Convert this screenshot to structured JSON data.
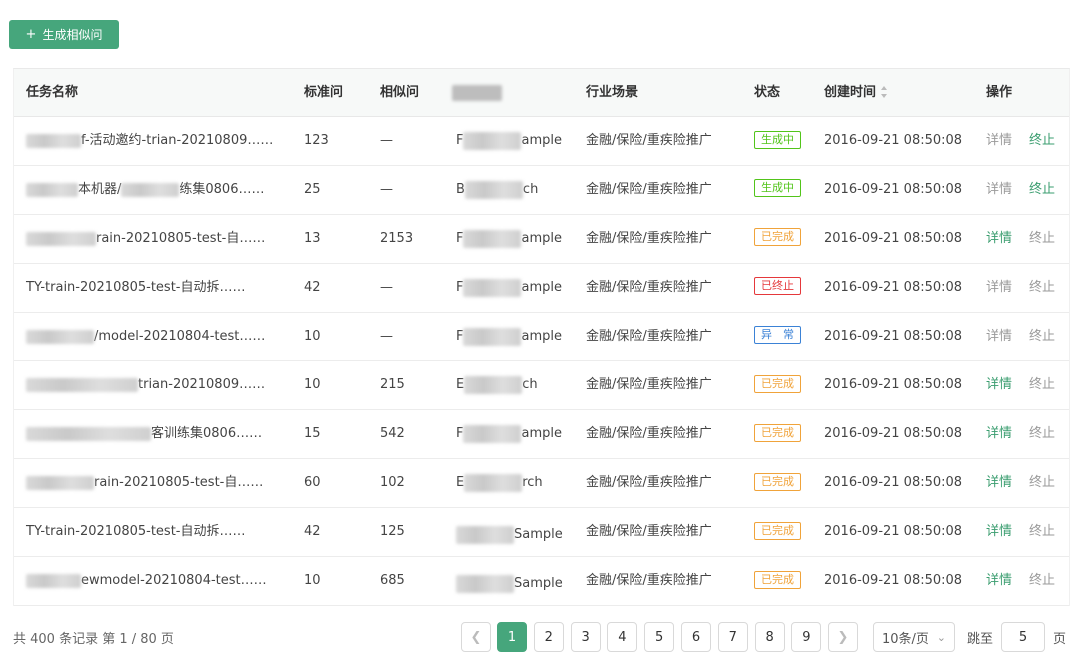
{
  "toolbar": {
    "generate_label": "生成相似问",
    "plus": "+"
  },
  "table": {
    "headers": {
      "name": "任务名称",
      "standard": "标准问",
      "similar": "相似问",
      "model": "",
      "industry": "行业场景",
      "status": "状态",
      "created": "创建时间",
      "actions": "操作"
    },
    "action_labels": {
      "detail": "详情",
      "stop": "终止"
    },
    "rows": [
      {
        "name": "f-活动邀约-trian-20210809……",
        "std": "123",
        "sim": "—",
        "model_pre": "F",
        "model_post": "ample",
        "industry": "金融/保险/重疾险推广",
        "status": "生成中",
        "time": "2016-09-21  08:50:08"
      },
      {
        "name": "本机器/",
        "name2": "练集0806……",
        "std": "25",
        "sim": "—",
        "model_pre": "B",
        "model_post": "ch",
        "industry": "金融/保险/重疾险推广",
        "status": "生成中",
        "time": "2016-09-21  08:50:08"
      },
      {
        "name": "rain-20210805-test-自……",
        "std": "13",
        "sim": "2153",
        "model_pre": "F",
        "model_post": "ample",
        "industry": "金融/保险/重疾险推广",
        "status": "已完成",
        "time": "2016-09-21  08:50:08"
      },
      {
        "name": "TY-train-20210805-test-自动拆……",
        "std": "42",
        "sim": "—",
        "model_pre": "F",
        "model_post": "ample",
        "industry": "金融/保险/重疾险推广",
        "status": "已终止",
        "time": "2016-09-21  08:50:08"
      },
      {
        "name": "/model-20210804-test……",
        "std": "10",
        "sim": "—",
        "model_pre": "F",
        "model_post": "ample",
        "industry": "金融/保险/重疾险推广",
        "status": "异　常",
        "time": "2016-09-21  08:50:08"
      },
      {
        "name": "trian-20210809……",
        "std": "10",
        "sim": "215",
        "model_pre": "E",
        "model_post": "ch",
        "industry": "金融/保险/重疾险推广",
        "status": "已完成",
        "time": "2016-09-21  08:50:08"
      },
      {
        "name": "客训练集0806……",
        "std": "15",
        "sim": "542",
        "model_pre": "F",
        "model_post": "ample",
        "industry": "金融/保险/重疾险推广",
        "status": "已完成",
        "time": "2016-09-21  08:50:08"
      },
      {
        "name": "rain-20210805-test-自……",
        "std": "60",
        "sim": "102",
        "model_pre": "E",
        "model_post": "rch",
        "industry": "金融/保险/重疾险推广",
        "status": "已完成",
        "time": "2016-09-21  08:50:08"
      },
      {
        "name": "TY-train-20210805-test-自动拆……",
        "std": "42",
        "sim": "125",
        "model_pre": "",
        "model_post": "Sample",
        "industry": "金融/保险/重疾险推广",
        "status": "已完成",
        "time": "2016-09-21  08:50:08"
      },
      {
        "name": "ewmodel-20210804-test……",
        "std": "10",
        "sim": "685",
        "model_pre": "",
        "model_post": "Sample",
        "industry": "金融/保险/重疾险推广",
        "status": "已完成",
        "time": "2016-09-21  08:50:08"
      }
    ]
  },
  "status_colors": {
    "生成中": "#52c41a",
    "已完成": "#f0a33a",
    "已终止": "#e5383b",
    "异　常": "#3b82d6"
  },
  "link_colors": {
    "active": "#3a9d6f",
    "muted": "#9a9a9a"
  },
  "accent": "#46a67c",
  "pagination": {
    "total_text": "共 400 条记录 第 1 / 80 页",
    "pages": [
      "1",
      "2",
      "3",
      "4",
      "5",
      "6",
      "7",
      "8",
      "9"
    ],
    "current": "1",
    "page_size": "10条/页",
    "jump_label": "跳至",
    "jump_value": "5",
    "page_suffix": "页"
  }
}
